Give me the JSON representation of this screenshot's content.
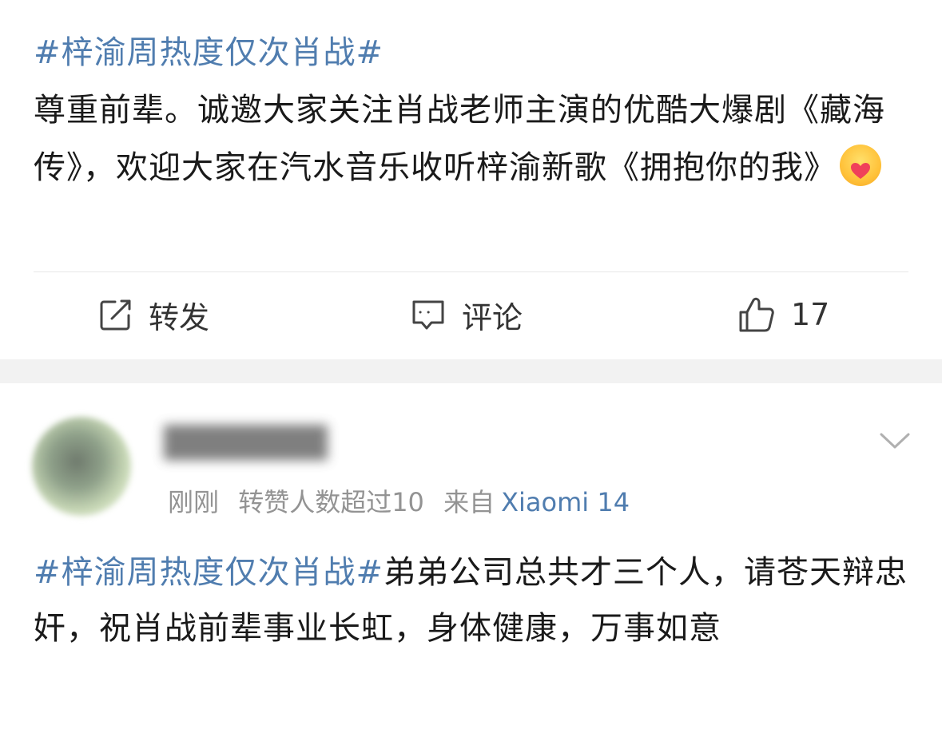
{
  "post1": {
    "hashtag": "#梓渝周热度仅次肖战#",
    "body": "尊重前辈。诚邀大家关注肖战老师主演的优酷大爆剧《藏海传》，欢迎大家在汽水音乐收听梓渝新歌《拥抱你的我》",
    "emoji": "hug-emoji"
  },
  "actions": {
    "repost_label": "转发",
    "comment_label": "评论",
    "like_count": "17"
  },
  "post2": {
    "username": "███████",
    "meta": {
      "time": "刚刚",
      "reposts": "转赞人数超过10",
      "source_prefix": "来自",
      "source_device": "Xiaomi 14"
    },
    "hashtag": "#梓渝周热度仅次肖战#",
    "body": "弟弟公司总共才三个人，请苍天辩忠奸，祝肖战前辈事业长虹，身体健康，万事如意"
  },
  "colors": {
    "link": "#507daf",
    "meta": "#939393",
    "text": "#1a1a1a",
    "separator": "#f2f2f2"
  }
}
